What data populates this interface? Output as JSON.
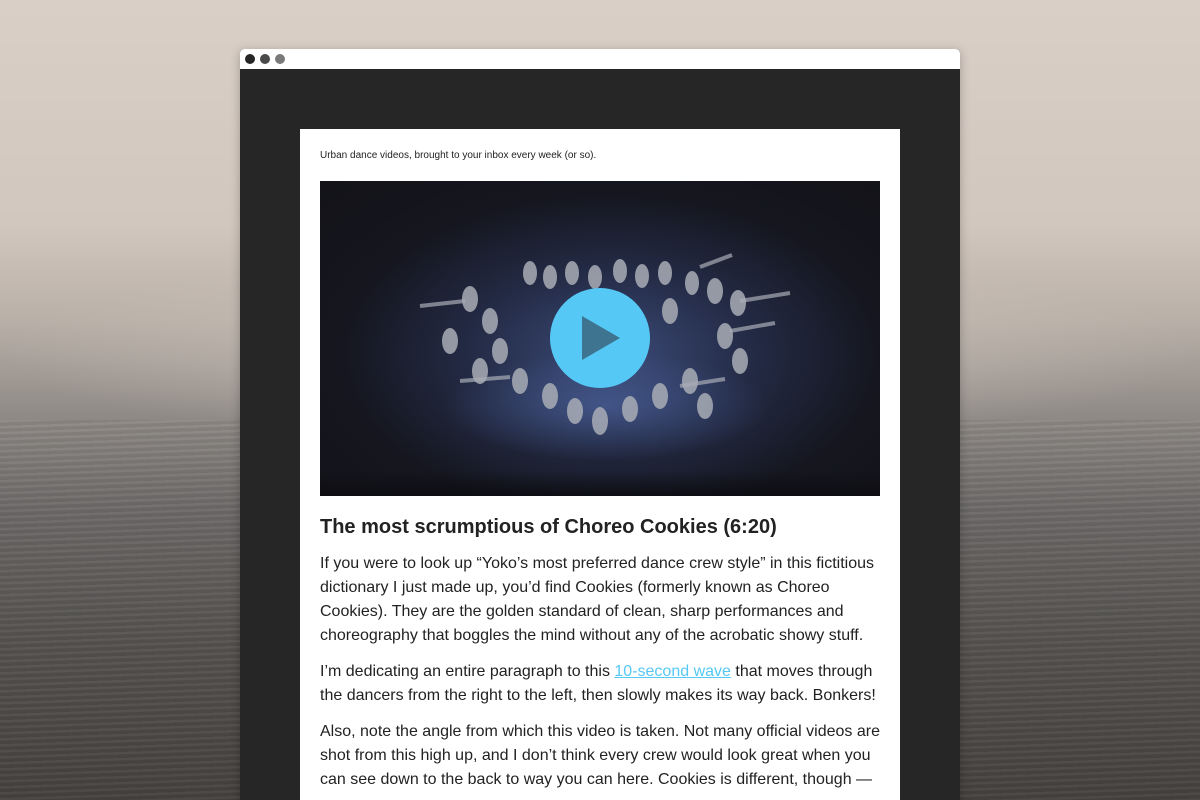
{
  "window": {
    "controls": [
      "close",
      "minimize",
      "maximize"
    ]
  },
  "email": {
    "tagline": "Urban dance videos, brought to your inbox every week (or so).",
    "video": {
      "play_icon": "play-icon",
      "play_color": "#55c8f5"
    },
    "article": {
      "title": "The most scrumptious of Choreo Cookies (6:20)",
      "paragraph1": "If you were to look up “Yoko’s most preferred dance crew style” in this fictitious dictionary I just made up, you’d find Cookies (formerly known as Choreo Cookies). They are the golden standard of clean, sharp performances and choreography that boggles the mind without any of the acrobatic showy stuff.",
      "paragraph2_before": "I’m dedicating an entire paragraph to this ",
      "paragraph2_link": "10-second wave",
      "paragraph2_after": " that moves through the dancers from the right to the left, then slowly makes its way back. Bonkers!",
      "paragraph3": "Also, note the angle from which this video is taken. Not many official videos are shot from this high up, and I don’t think every crew would look great when you can see down to the back to way you can here. Cookies is different, though —"
    }
  },
  "colors": {
    "link": "#55c8f5",
    "window_bg": "#262626",
    "text": "#222222"
  }
}
